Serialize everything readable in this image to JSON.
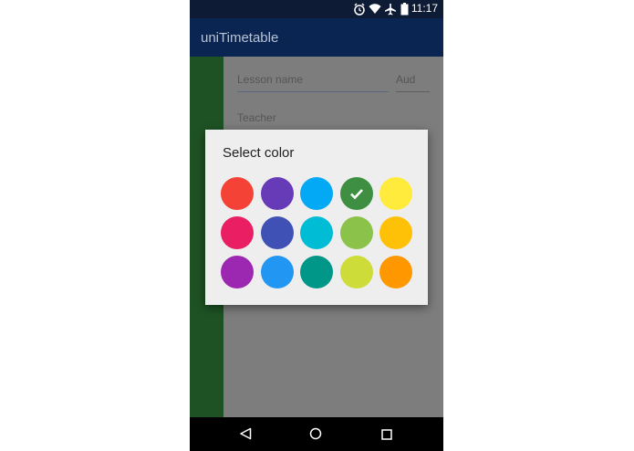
{
  "status_bar": {
    "time": "11:17",
    "icons": [
      "alarm-icon",
      "wifi-icon",
      "airplane-icon",
      "battery-icon"
    ]
  },
  "app_bar": {
    "title": "uniTimetable"
  },
  "form": {
    "lesson_name_placeholder": "Lesson name",
    "aud_placeholder": "Aud",
    "teacher_placeholder": "Teacher"
  },
  "dialog": {
    "title": "Select color",
    "colors": [
      [
        "#f44336",
        "#673ab7",
        "#03a9f4",
        "#4caf50",
        "#ffeb3b"
      ],
      [
        "#e91e63",
        "#3f51b5",
        "#00bcd4",
        "#8bc34a",
        "#ffc107"
      ],
      [
        "#9c27b0",
        "#2196f3",
        "#009688",
        "#cddc39",
        "#ff9800"
      ]
    ],
    "selected": "#4caf50"
  },
  "colors": {
    "status_bar": "#0e1b35",
    "app_bar": "#0a2552",
    "sidebar": "#1e5224",
    "fab": "#0a2c55"
  },
  "fab": {
    "icon": "check-icon"
  },
  "nav_bar": {
    "icons": [
      "back-icon",
      "home-icon",
      "recents-icon"
    ]
  }
}
